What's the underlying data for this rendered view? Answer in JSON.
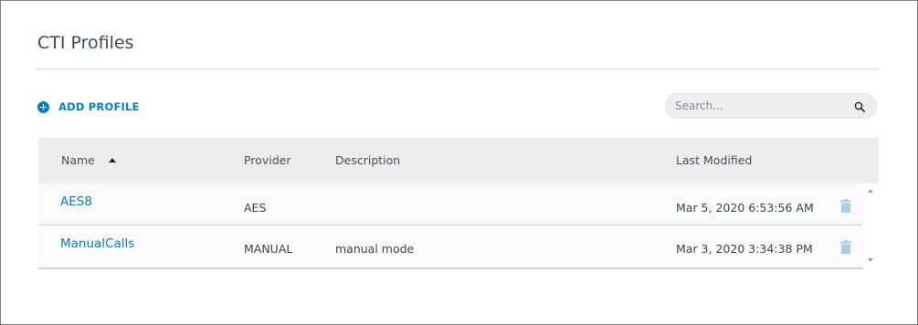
{
  "page": {
    "title": "CTI Profiles"
  },
  "toolbar": {
    "add_label": "ADD PROFILE",
    "search_placeholder": "Search..."
  },
  "table": {
    "columns": [
      "Name",
      "Provider",
      "Description",
      "Last Modified"
    ],
    "sorted_column": "Name",
    "sort_direction": "ascending",
    "rows": [
      {
        "name": "AES8",
        "provider": "AES",
        "description": "",
        "last_modified": "Mar 5, 2020 6:53:56 AM"
      },
      {
        "name": "ManualCalls",
        "provider": "MANUAL",
        "description": "manual mode",
        "last_modified": "Mar 3, 2020 3:34:38 PM"
      }
    ]
  },
  "icons": {
    "add": "plus-circle-icon",
    "search": "search-icon",
    "sort": "sort-ascending-icon",
    "delete": "trash-icon"
  },
  "colors": {
    "accent": "#0a7fc2",
    "header_bg": "#ededed",
    "row_bg": "#fafafa",
    "trash": "#a9cfe6"
  }
}
